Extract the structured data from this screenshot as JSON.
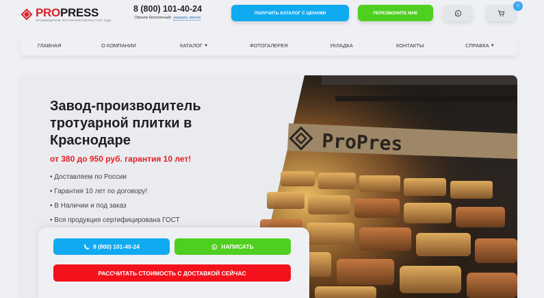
{
  "header": {
    "logo_name_red": "PRO",
    "logo_name_dark": "PRESS",
    "logo_subtitle": "ПРОИЗВОДИТЕЛЬ ТРОТУАРНОЙ ПЛИТКИ С 2007 ГОДА",
    "phone": "8 (800) 101-40-24",
    "phone_note": "(Звонок бесплатный)",
    "callback_link": "заказать звонок",
    "catalog_button": "ПОЛУЧИТЬ КАТАЛОГ С ЦЕНАМИ",
    "callback_button": "ПЕРЕЗВОНИТЕ МНЕ",
    "cart_count": "0"
  },
  "nav": {
    "items": [
      "ГЛАВНАЯ",
      "О КОМПАНИИ",
      "КАТАЛОГ",
      "ФОТОГАЛЕРЕЯ",
      "УКЛАДКА",
      "КОНТАКТЫ",
      "СПРАВКА"
    ]
  },
  "hero": {
    "title": "Завод-производитель тротуарной плитки в Краснодаре",
    "price": "от 380 до 950 руб. гарантия 10 лет!",
    "bullets": [
      "• Доставляем по России",
      "• Гарантия 10 лет по договору!",
      "• В Наличии и под заказ",
      "• Вся продукция сертифицирована ГОСТ"
    ],
    "photo_sign": "ProPres",
    "phone_button": "8 (800) 101-40-24",
    "write_button": "НАПИСАТЬ",
    "calc_button": "РАССЧИТАТЬ СТОИМОСТЬ С ДОСТАВКОЙ СЕЙЧАС"
  },
  "colors": {
    "brand_red": "#d61f26",
    "accent_blue": "#10aaf0",
    "accent_green": "#4fcf1f",
    "cta_red": "#f3121c"
  },
  "icons": [
    "logo-diamond-icon",
    "whatsapp-icon",
    "cart-icon",
    "phone-icon",
    "caret-down-icon"
  ]
}
